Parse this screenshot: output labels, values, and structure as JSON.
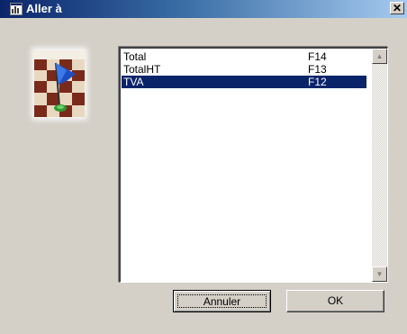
{
  "window": {
    "title": "Aller à",
    "close_glyph": "✕"
  },
  "icons": {
    "title": "app-window-icon",
    "image": "chess-flag-icon",
    "close": "close-icon",
    "scroll_up": "scroll-up-arrow-icon",
    "scroll_down": "scroll-down-arrow-icon"
  },
  "list": {
    "items": [
      {
        "name": "Total",
        "key": "F14",
        "selected": false
      },
      {
        "name": "TotalHT",
        "key": "F13",
        "selected": false
      },
      {
        "name": "TVA",
        "key": "F12",
        "selected": true
      }
    ],
    "scroll_up_glyph": "▲",
    "scroll_down_glyph": "▼"
  },
  "buttons": {
    "cancel_label": "Annuler",
    "ok_label": "OK"
  },
  "colors": {
    "selection": "#0a246a",
    "titlebar_start": "#0a246a",
    "titlebar_end": "#a6caf0",
    "face": "#d4d0c8"
  }
}
